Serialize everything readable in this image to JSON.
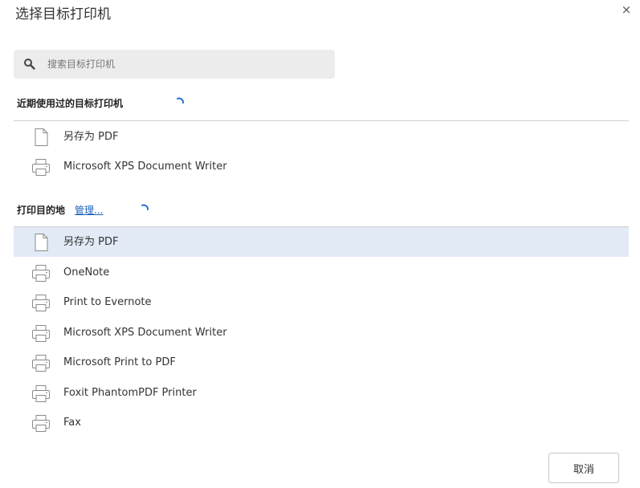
{
  "dialog": {
    "title": "选择目标打印机",
    "close_glyph": "×"
  },
  "search": {
    "placeholder": "搜索目标打印机",
    "value": ""
  },
  "recent": {
    "header": "近期使用过的目标打印机",
    "items": [
      {
        "label": "另存为 PDF",
        "icon": "pdf-file-icon"
      },
      {
        "label": "Microsoft XPS Document Writer",
        "icon": "printer-icon"
      }
    ]
  },
  "destinations": {
    "header": "打印目的地",
    "manage_label": "管理...",
    "items": [
      {
        "label": "另存为 PDF",
        "icon": "pdf-file-icon",
        "selected": true
      },
      {
        "label": "OneNote",
        "icon": "printer-icon"
      },
      {
        "label": "Print to Evernote",
        "icon": "printer-icon"
      },
      {
        "label": "Microsoft XPS Document Writer",
        "icon": "printer-icon"
      },
      {
        "label": "Microsoft Print to PDF",
        "icon": "printer-icon"
      },
      {
        "label": "Foxit PhantomPDF Printer",
        "icon": "printer-icon"
      },
      {
        "label": "Fax",
        "icon": "printer-icon"
      }
    ]
  },
  "footer": {
    "cancel_label": "取消"
  },
  "colors": {
    "selected_row": "#e2eaf6",
    "link": "#1a5fb4",
    "spinner": "#2a6fd6",
    "search_bg": "#ececec"
  }
}
